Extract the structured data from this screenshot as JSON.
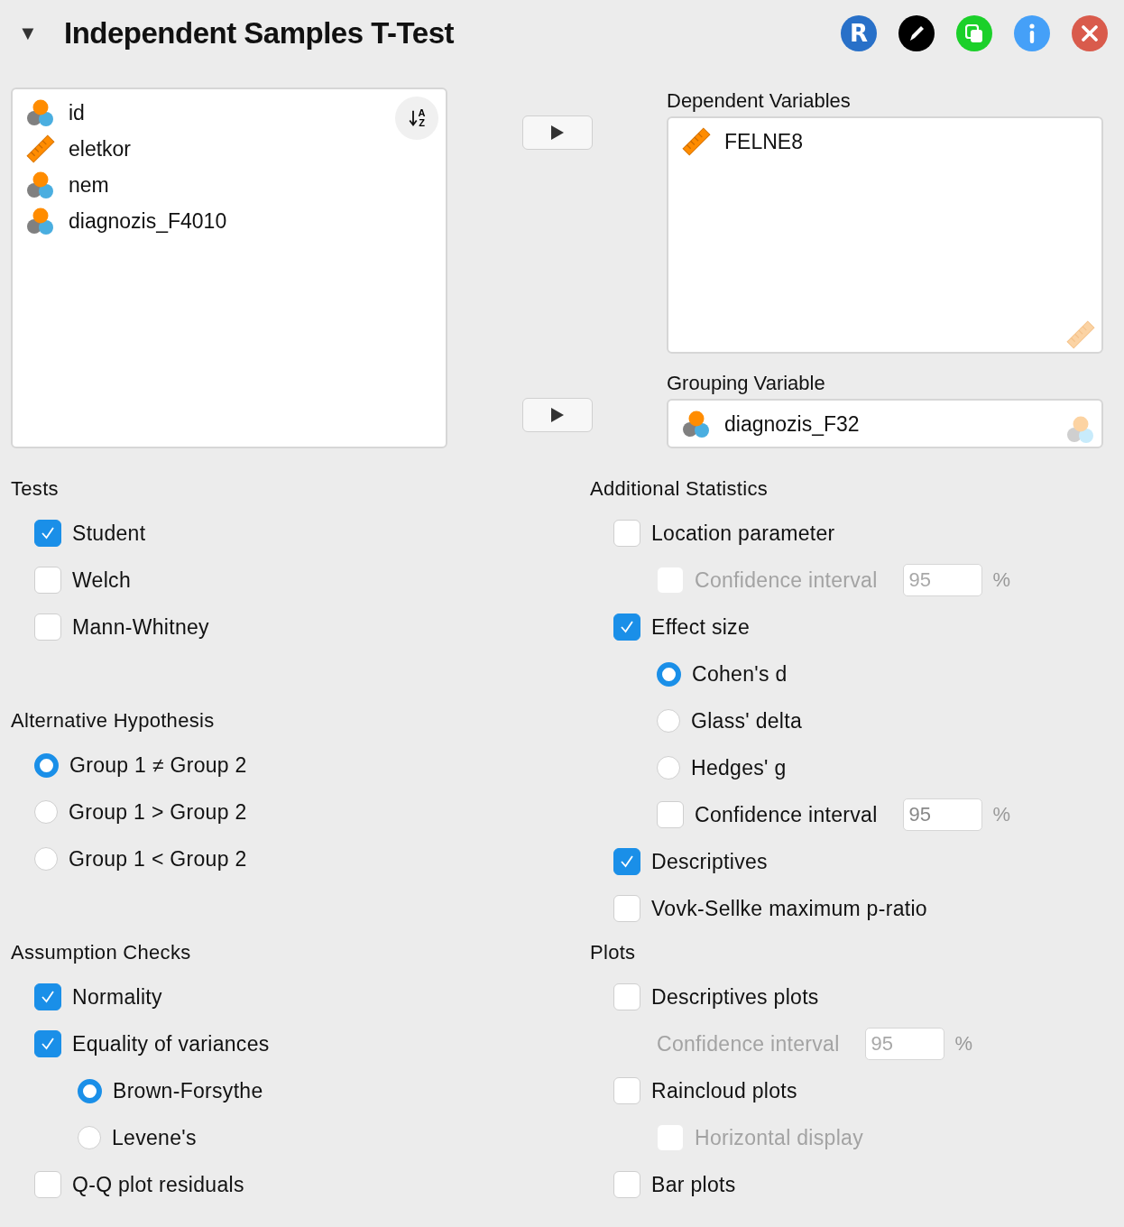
{
  "header": {
    "collapse_glyph": "▼",
    "title": "Independent Samples T-Test",
    "buttons": [
      {
        "kind": "r",
        "label": "R"
      },
      {
        "kind": "edit"
      },
      {
        "kind": "duplicate"
      },
      {
        "kind": "info"
      },
      {
        "kind": "close"
      }
    ]
  },
  "variables": {
    "sort_letters": [
      "A",
      "Z"
    ],
    "available": [
      {
        "name": "id",
        "kind": "nominal"
      },
      {
        "name": "eletkor",
        "kind": "scale"
      },
      {
        "name": "nem",
        "kind": "nominal"
      },
      {
        "name": "diagnozis_F4010",
        "kind": "nominal"
      }
    ],
    "targets": [
      {
        "label": "Dependent Variables",
        "kind": "list",
        "hint": {
          "kind": "scale"
        },
        "variables": [
          {
            "name": "FELNE8",
            "kind": "scale"
          }
        ]
      },
      {
        "label": "Grouping Variable",
        "kind": "single",
        "hint": {
          "kind": "nominal"
        },
        "variables": [
          {
            "name": "diagnozis_F32",
            "kind": "nominal"
          }
        ]
      }
    ]
  },
  "left_sections": [
    {
      "title": "Tests",
      "items": [
        {
          "kind": "checkbox",
          "label": "Student",
          "checked": true,
          "disabled": false
        },
        {
          "kind": "checkbox",
          "label": "Welch",
          "checked": false,
          "disabled": false
        },
        {
          "kind": "checkbox",
          "label": "Mann-Whitney",
          "checked": false,
          "disabled": false
        }
      ]
    },
    {
      "title": "Alternative Hypothesis",
      "items": [
        {
          "kind": "radio",
          "label": "Group 1 ≠ Group 2",
          "selected": true
        },
        {
          "kind": "radio",
          "label": "Group 1 > Group 2",
          "selected": false
        },
        {
          "kind": "radio",
          "label": "Group 1 < Group 2",
          "selected": false
        }
      ]
    },
    {
      "title": "Assumption Checks",
      "items": [
        {
          "kind": "checkbox",
          "label": "Normality",
          "checked": true,
          "disabled": false
        },
        {
          "kind": "checkbox",
          "label": "Equality of variances",
          "checked": true,
          "disabled": false,
          "children": [
            {
              "kind": "radio",
              "label": "Brown-Forsythe",
              "selected": true
            },
            {
              "kind": "radio",
              "label": "Levene's",
              "selected": false
            }
          ]
        },
        {
          "kind": "checkbox",
          "label": "Q-Q plot residuals",
          "checked": false,
          "disabled": false
        }
      ]
    }
  ],
  "right_sections": [
    {
      "title": "Additional Statistics",
      "items": [
        {
          "kind": "checkbox",
          "label": "Location parameter",
          "checked": false,
          "disabled": false,
          "children": [
            {
              "kind": "checkbox",
              "label": "Confidence interval",
              "checked": false,
              "disabled": true,
              "value": "95",
              "unit": "%"
            }
          ]
        },
        {
          "kind": "checkbox",
          "label": "Effect size",
          "checked": true,
          "disabled": false,
          "children": [
            {
              "kind": "radio",
              "label": "Cohen's d",
              "selected": true
            },
            {
              "kind": "radio",
              "label": "Glass' delta",
              "selected": false
            },
            {
              "kind": "radio",
              "label": "Hedges' g",
              "selected": false
            },
            {
              "kind": "checkbox",
              "label": "Confidence interval",
              "checked": false,
              "disabled": false,
              "value": "95",
              "unit": "%"
            }
          ]
        },
        {
          "kind": "checkbox",
          "label": "Descriptives",
          "checked": true,
          "disabled": false
        },
        {
          "kind": "checkbox",
          "label": "Vovk-Sellke maximum p-ratio",
          "checked": false,
          "disabled": false
        }
      ]
    },
    {
      "title": "Plots",
      "items": [
        {
          "kind": "checkbox",
          "label": "Descriptives plots",
          "checked": false,
          "disabled": false,
          "children": [
            {
              "kind": "field",
              "label": "Confidence interval",
              "disabled": true,
              "value": "95",
              "unit": "%"
            }
          ]
        },
        {
          "kind": "checkbox",
          "label": "Raincloud plots",
          "checked": false,
          "disabled": false,
          "children": [
            {
              "kind": "checkbox",
              "label": "Horizontal display",
              "checked": false,
              "disabled": true
            }
          ]
        },
        {
          "kind": "checkbox",
          "label": "Bar plots",
          "checked": false,
          "disabled": false
        }
      ]
    }
  ]
}
